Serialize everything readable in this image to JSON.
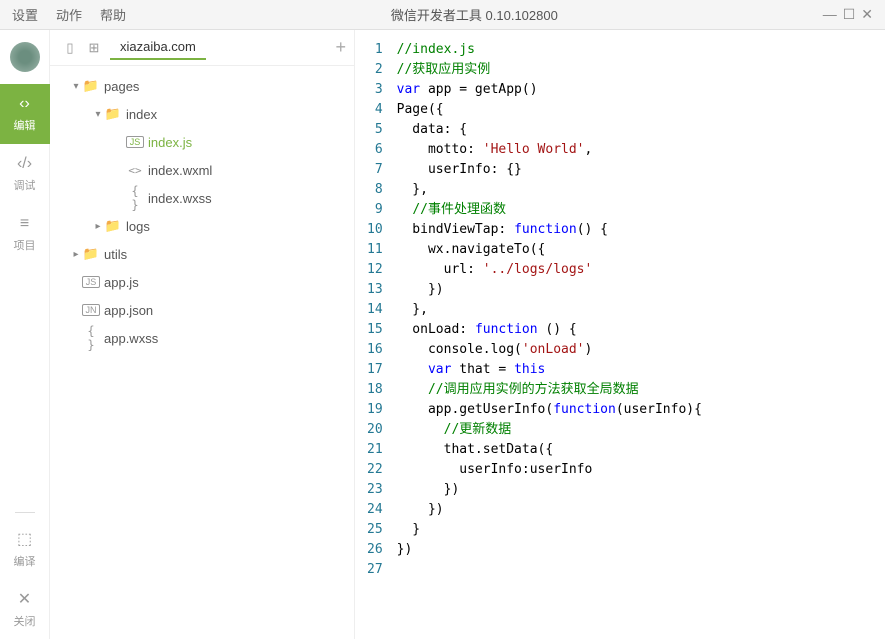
{
  "titlebar": {
    "menus": {
      "settings": "设置",
      "actions": "动作",
      "help": "帮助"
    },
    "title": "微信开发者工具 0.10.102800"
  },
  "sidebar": {
    "edit": "编辑",
    "debug": "调试",
    "project": "项目",
    "compile": "编译",
    "close": "关闭"
  },
  "explorer": {
    "tab": "xiazaiba.com",
    "tree": {
      "pages": "pages",
      "index": "index",
      "indexjs": "index.js",
      "indexwxml": "index.wxml",
      "indexwxss": "index.wxss",
      "logs": "logs",
      "utils": "utils",
      "appjs": "app.js",
      "appjson": "app.json",
      "appwxss": "app.wxss"
    }
  },
  "code": {
    "lines": [
      {
        "n": 1,
        "seg": [
          {
            "c": "c-comment",
            "t": "//index.js"
          }
        ]
      },
      {
        "n": 2,
        "seg": [
          {
            "c": "c-comment",
            "t": "//获取应用实例"
          }
        ]
      },
      {
        "n": 3,
        "seg": [
          {
            "c": "c-keyword",
            "t": "var"
          },
          {
            "c": "c-plain",
            "t": " app = getApp()"
          }
        ]
      },
      {
        "n": 4,
        "seg": [
          {
            "c": "c-plain",
            "t": "Page({"
          }
        ]
      },
      {
        "n": 5,
        "seg": [
          {
            "c": "c-plain",
            "t": "  data: {"
          }
        ]
      },
      {
        "n": 6,
        "seg": [
          {
            "c": "c-plain",
            "t": "    motto: "
          },
          {
            "c": "c-string",
            "t": "'Hello World'"
          },
          {
            "c": "c-plain",
            "t": ","
          }
        ]
      },
      {
        "n": 7,
        "seg": [
          {
            "c": "c-plain",
            "t": "    userInfo: {}"
          }
        ]
      },
      {
        "n": 8,
        "seg": [
          {
            "c": "c-plain",
            "t": "  },"
          }
        ]
      },
      {
        "n": 9,
        "seg": [
          {
            "c": "c-plain",
            "t": "  "
          },
          {
            "c": "c-comment",
            "t": "//事件处理函数"
          }
        ]
      },
      {
        "n": 10,
        "seg": [
          {
            "c": "c-plain",
            "t": "  bindViewTap: "
          },
          {
            "c": "c-keyword",
            "t": "function"
          },
          {
            "c": "c-plain",
            "t": "() {"
          }
        ]
      },
      {
        "n": 11,
        "seg": [
          {
            "c": "c-plain",
            "t": "    wx.navigateTo({"
          }
        ]
      },
      {
        "n": 12,
        "seg": [
          {
            "c": "c-plain",
            "t": "      url: "
          },
          {
            "c": "c-string",
            "t": "'../logs/logs'"
          }
        ]
      },
      {
        "n": 13,
        "seg": [
          {
            "c": "c-plain",
            "t": "    })"
          }
        ]
      },
      {
        "n": 14,
        "seg": [
          {
            "c": "c-plain",
            "t": "  },"
          }
        ]
      },
      {
        "n": 15,
        "seg": [
          {
            "c": "c-plain",
            "t": "  onLoad: "
          },
          {
            "c": "c-keyword",
            "t": "function"
          },
          {
            "c": "c-plain",
            "t": " () {"
          }
        ]
      },
      {
        "n": 16,
        "seg": [
          {
            "c": "c-plain",
            "t": "    console.log("
          },
          {
            "c": "c-string",
            "t": "'onLoad'"
          },
          {
            "c": "c-plain",
            "t": ")"
          }
        ]
      },
      {
        "n": 17,
        "seg": [
          {
            "c": "c-plain",
            "t": "    "
          },
          {
            "c": "c-keyword",
            "t": "var"
          },
          {
            "c": "c-plain",
            "t": " that = "
          },
          {
            "c": "c-keyword",
            "t": "this"
          }
        ]
      },
      {
        "n": 18,
        "seg": [
          {
            "c": "c-plain",
            "t": "    "
          },
          {
            "c": "c-comment",
            "t": "//调用应用实例的方法获取全局数据"
          }
        ]
      },
      {
        "n": 19,
        "seg": [
          {
            "c": "c-plain",
            "t": "    app.getUserInfo("
          },
          {
            "c": "c-keyword",
            "t": "function"
          },
          {
            "c": "c-plain",
            "t": "(userInfo){"
          }
        ]
      },
      {
        "n": 20,
        "seg": [
          {
            "c": "c-plain",
            "t": "      "
          },
          {
            "c": "c-comment",
            "t": "//更新数据"
          }
        ]
      },
      {
        "n": 21,
        "seg": [
          {
            "c": "c-plain",
            "t": "      that.setData({"
          }
        ]
      },
      {
        "n": 22,
        "seg": [
          {
            "c": "c-plain",
            "t": "        userInfo:userInfo"
          }
        ]
      },
      {
        "n": 23,
        "seg": [
          {
            "c": "c-plain",
            "t": "      })"
          }
        ]
      },
      {
        "n": 24,
        "seg": [
          {
            "c": "c-plain",
            "t": "    })"
          }
        ]
      },
      {
        "n": 25,
        "seg": [
          {
            "c": "c-plain",
            "t": "  }"
          }
        ]
      },
      {
        "n": 26,
        "seg": [
          {
            "c": "c-plain",
            "t": "})"
          }
        ]
      },
      {
        "n": 27,
        "seg": [
          {
            "c": "c-plain",
            "t": ""
          }
        ]
      }
    ]
  }
}
